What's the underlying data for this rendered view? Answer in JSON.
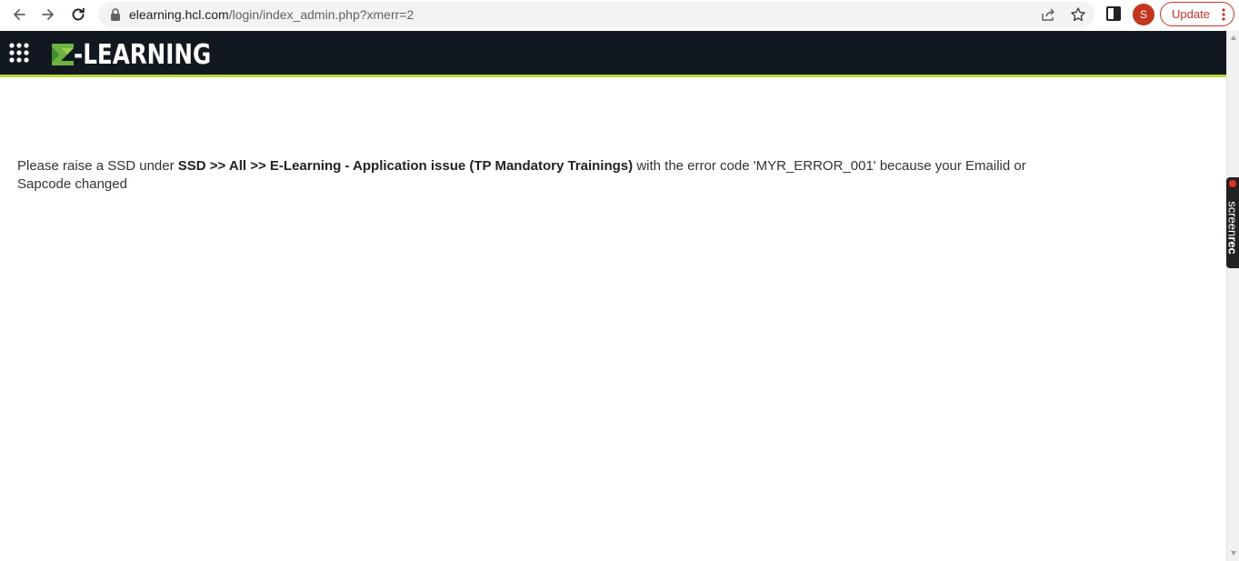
{
  "browser": {
    "url_host": "elearning.hcl.com",
    "url_path": "/login/index_admin.php?xmerr=2",
    "avatar_initial": "S",
    "update_label": "Update",
    "accent_color": "#d93025"
  },
  "header": {
    "logo_text": "-LEARNING",
    "background_color": "#111820",
    "accent_color": "#b8d936"
  },
  "message": {
    "prefix": "Please raise a SSD under ",
    "path": "SSD >> All >> E-Learning - Application issue (TP Mandatory Trainings)",
    "suffix": " with the error code 'MYR_ERROR_001' because your Emailid or Sapcode changed"
  },
  "screenrec": {
    "label_light": "screen",
    "label_bold": "rec"
  }
}
